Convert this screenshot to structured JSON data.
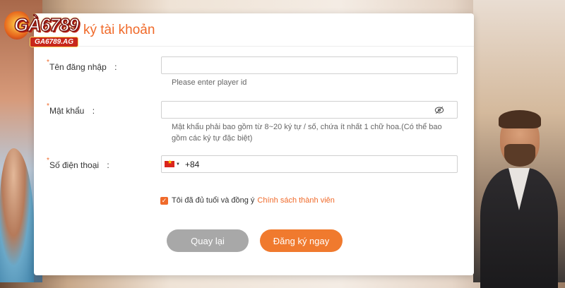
{
  "brand": {
    "name": "GÀ6789",
    "domain": "GA6789.AG"
  },
  "dialog": {
    "title": "ký tài khoản"
  },
  "form": {
    "username": {
      "label": "Tên đăng nhập",
      "colon": ":",
      "value": "",
      "hint": "Please enter player id"
    },
    "password": {
      "label": "Mật khẩu",
      "colon": ":",
      "value": "",
      "hint": "Mật khẩu phải bao gồm từ 8~20 ký tự / số, chứa ít nhất 1 chữ hoa.(Có thể bao gồm các ký tự đặc biệt)",
      "icon": "eye-slash-icon"
    },
    "phone": {
      "label": "Số điện thoại",
      "colon": ":",
      "country_code": "+84",
      "flag": "vietnam-flag-icon",
      "value": ""
    },
    "agreement": {
      "checked": true,
      "text": "Tôi đã đủ tuổi và đồng ý",
      "link": "Chính sách thành viên"
    }
  },
  "buttons": {
    "back": "Quay lại",
    "register": "Đăng ký ngay"
  },
  "colors": {
    "accent": "#f06a2a",
    "back_button": "#a8a8a8",
    "register_button": "#f07a2e"
  }
}
